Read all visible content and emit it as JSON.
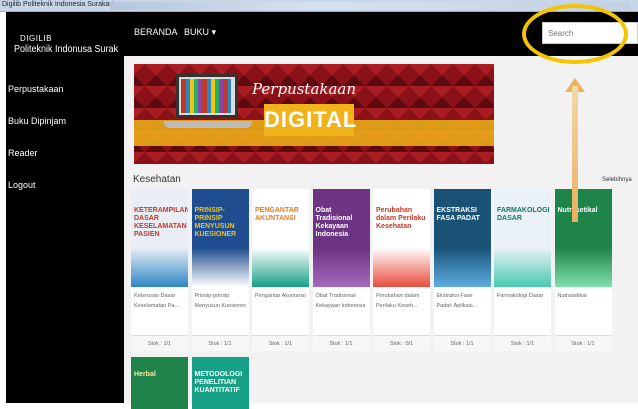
{
  "window": {
    "title": "Digilib Politeknik Indonesia Surakarta"
  },
  "brand": {
    "line1": "DIGILIB",
    "line2": "Politeknik Indonusa Surakarta"
  },
  "sidebar": {
    "items": [
      {
        "label": "Perpustakaan"
      },
      {
        "label": "Buku Dipinjam"
      },
      {
        "label": "Reader"
      },
      {
        "label": "Logout"
      }
    ]
  },
  "topnav": {
    "links": [
      {
        "label": "BERANDA"
      },
      {
        "label": "BUKU ▾"
      }
    ]
  },
  "search": {
    "placeholder": "Search"
  },
  "banner": {
    "title": "Perpustakaan",
    "subtitle": "DIGITAL"
  },
  "section": {
    "title": "Kesehatan",
    "more": "Selebihnya"
  },
  "books": [
    {
      "title": "Keterusan Dasar Keselamatan Pa...",
      "stock": "Stok : 1/1",
      "cover_title": "KETERAMPILAN DASAR KESELAMATAN PASIEN",
      "bg": "#e9eef6",
      "fg": "#c0392b",
      "accent": "#2e86c1"
    },
    {
      "title": "Prinsip-prinsip Menyusun Kuesioner",
      "stock": "Stok : 1/1",
      "cover_title": "PRINSIP-PRINSIP MENYUSUN KUESIONER",
      "bg": "#1f4d8f",
      "fg": "#f1c40f",
      "accent": "#ffffff"
    },
    {
      "title": "Pengantar Akuntansi",
      "stock": "Stok : 1/1",
      "cover_title": "PENGANTAR AKUNTANSI",
      "bg": "#ffffff",
      "fg": "#e67e22",
      "accent": "#16a085"
    },
    {
      "title": "Obat Tradisional Kekayaan Indonesia",
      "stock": "Stok : 1/1",
      "cover_title": "Obat Tradisional Kekayaan Indonesia",
      "bg": "#6c3483",
      "fg": "#ffffff",
      "accent": "#a569bd"
    },
    {
      "title": "Perubahan dalam Perilaku Keseh...",
      "stock": "Stok : 0/1",
      "cover_title": "Perubahan dalam Perilaku Kesehatan",
      "bg": "#ffffff",
      "fg": "#c0392b",
      "accent": "#e74c3c"
    },
    {
      "title": "Ekstraksi Fase Padat: Aplikasi...",
      "stock": "Stok : 1/1",
      "cover_title": "EKSTRAKSI FASA PADAT",
      "bg": "#1a5276",
      "fg": "#ffffff",
      "accent": "#5dade2"
    },
    {
      "title": "Farmakologi Dasar",
      "stock": "Stok : 1/1",
      "cover_title": "FARMAKOLOGI DASAR",
      "bg": "#eaf2f8",
      "fg": "#117864",
      "accent": "#48c9b0"
    },
    {
      "title": "Nutrasetikal",
      "stock": "Stok : 1/1",
      "cover_title": "Nutrasetikal",
      "bg": "#1e8449",
      "fg": "#ffffff",
      "accent": "#82e0aa"
    }
  ],
  "books_row2": [
    {
      "cover_title": "Herbal",
      "bg": "#1e8449",
      "fg": "#f9e79f"
    },
    {
      "cover_title": "METODOLOGI PENELITIAN KUANTITATIF",
      "bg": "#16a085",
      "fg": "#ffffff"
    }
  ]
}
